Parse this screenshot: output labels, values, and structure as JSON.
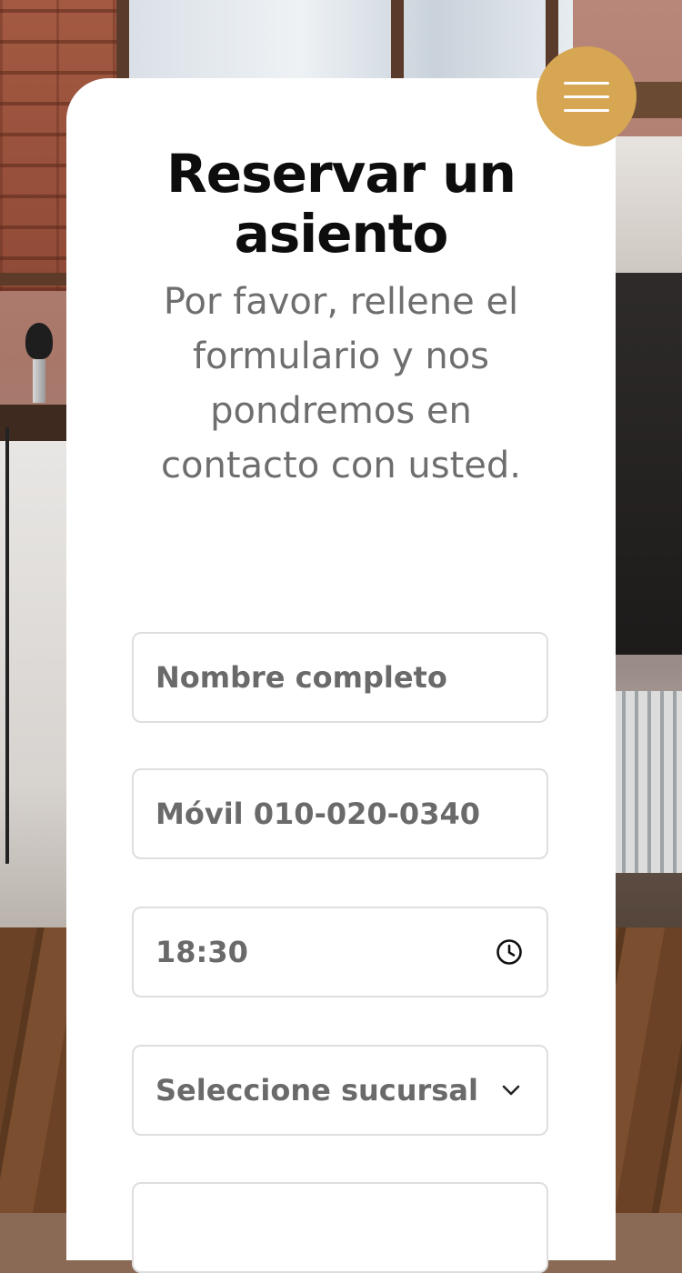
{
  "header": {
    "title": "Reservar un asiento",
    "subtitle": "Por favor, rellene el formulario y nos pondremos en contacto con usted.",
    "menu_icon": "hamburger-icon"
  },
  "form": {
    "name_placeholder": "Nombre completo",
    "phone_placeholder": "Móvil 010-020-0340",
    "time_value": "18:30",
    "time_icon": "clock-icon",
    "branch_placeholder": "Seleccione sucursal",
    "branch_icon": "chevron-down-icon",
    "extra_value": ""
  },
  "colors": {
    "accent": "#d6a652",
    "title": "#0d0d0d",
    "subtitle": "#6e6e6e",
    "field_text": "#6a6a6a",
    "field_border": "#dedede"
  }
}
